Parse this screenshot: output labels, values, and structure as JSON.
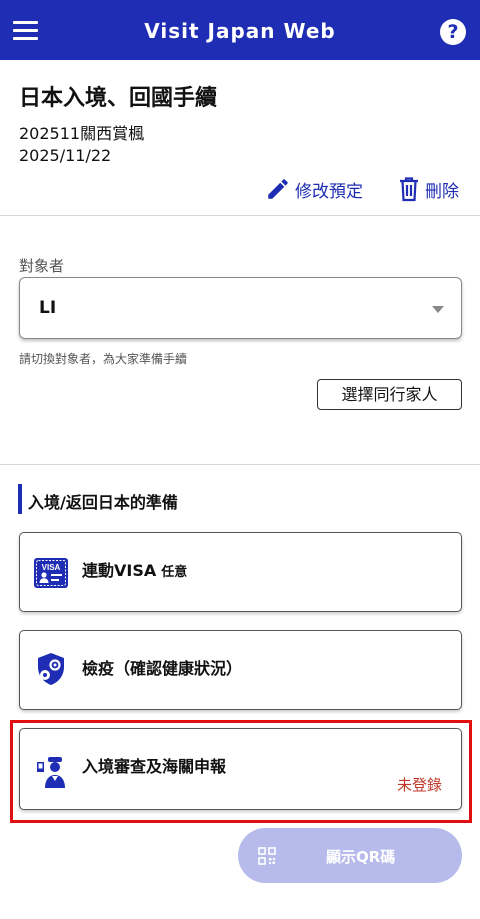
{
  "header": {
    "title": "Visit Japan Web",
    "menu_icon": "hamburger-menu-icon",
    "help_icon": "help-icon",
    "help_glyph": "?"
  },
  "trip": {
    "heading": "日本入境、回國手續",
    "name": "202511關西賞楓",
    "date": "2025/11/22",
    "edit_label": "修改預定",
    "delete_label": "刪除"
  },
  "person": {
    "label": "對象者",
    "selected": "LI",
    "helper": "請切換對象者，為大家準備手續",
    "companion_button": "選擇同行家人"
  },
  "section": {
    "title": "入境/返回日本的準備",
    "cards": [
      {
        "label": "連動VISA",
        "tag": "任意",
        "icon": "visa-card-icon"
      },
      {
        "label": "檢疫（確認健康狀況）",
        "icon": "shield-gear-icon"
      },
      {
        "label": "入境審查及海關申報",
        "status": "未登錄",
        "icon": "immigration-officer-icon"
      }
    ]
  },
  "qr_button": {
    "label": "顯示QR碼",
    "icon": "qr-code-icon"
  },
  "colors": {
    "primary": "#1e2db4",
    "status_red": "#c0392b",
    "highlight_red": "#e01010",
    "qr_button_bg": "#b6bbeb"
  }
}
